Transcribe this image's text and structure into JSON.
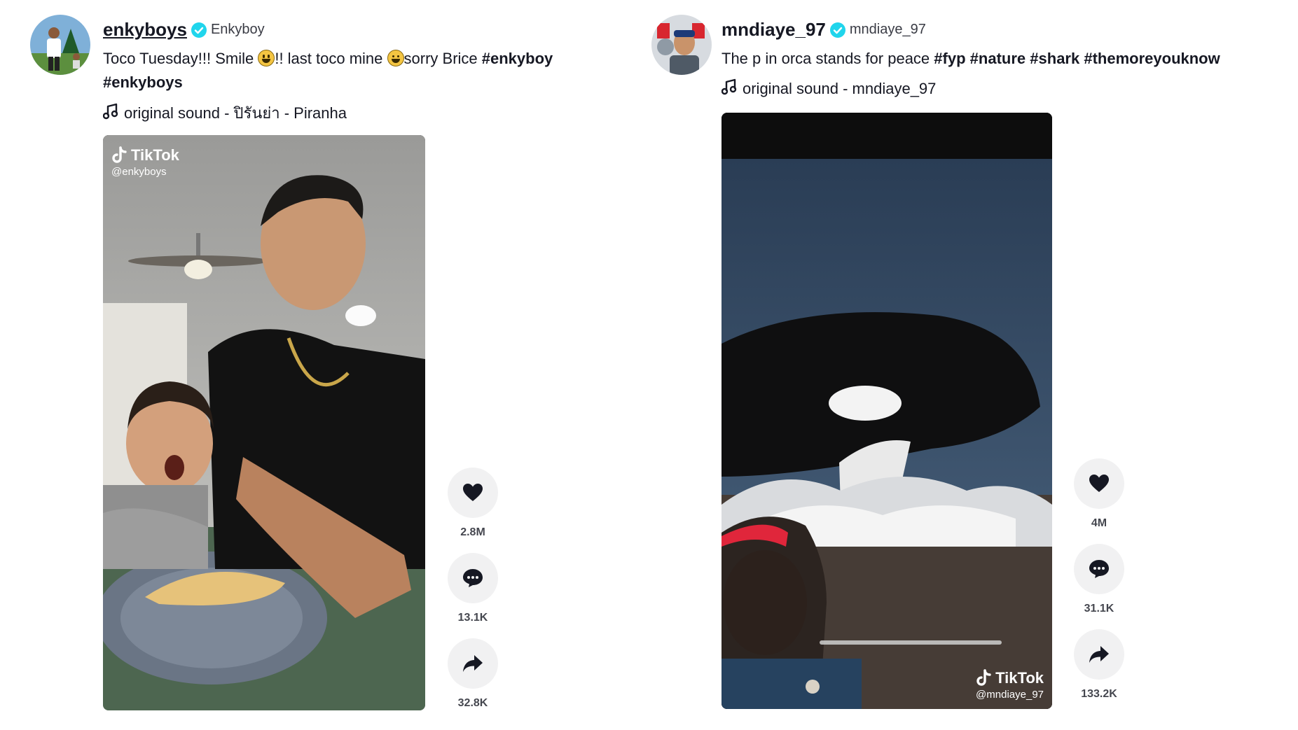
{
  "posts": [
    {
      "username": "enkyboys",
      "nickname": "Enkyboy",
      "caption_parts": {
        "p1": "Toco Tuesday!!! Smile ",
        "p2": "!! last toco mine ",
        "p3": "sorry Brice ",
        "tag1": "#enkyboy",
        "tag2": "#enkyboys"
      },
      "music": "original sound - ปิรันย่า - Piranha",
      "watermark_brand": "TikTok",
      "watermark_handle": "@enkyboys",
      "likes": "2.8M",
      "comments": "13.1K",
      "shares": "32.8K"
    },
    {
      "username": "mndiaye_97",
      "nickname": "mndiaye_97",
      "caption_parts": {
        "p1": "The p in orca stands for peace ",
        "tag1": "#fyp",
        "tag2": "#nature",
        "tag3": "#shark",
        "tag4": "#themoreyouknow"
      },
      "music": "original sound - mndiaye_97",
      "watermark_brand": "TikTok",
      "watermark_handle": "@mndiaye_97",
      "likes": "4M",
      "comments": "31.1K",
      "shares": "133.2K"
    }
  ],
  "colors": {
    "verified": "#20d5ec",
    "text": "#161823",
    "action_bg": "#f1f1f2"
  },
  "icons": [
    "music-note-icon",
    "verified-badge-icon",
    "heart-icon",
    "comment-icon",
    "share-icon",
    "tiktok-logo-icon"
  ]
}
